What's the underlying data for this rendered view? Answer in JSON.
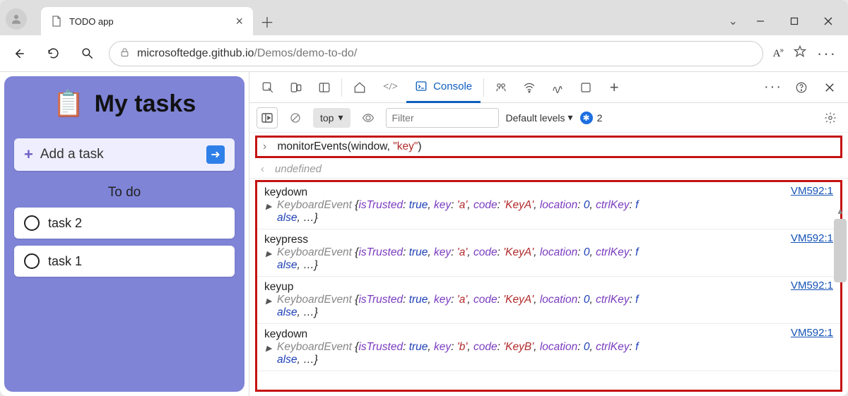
{
  "window": {
    "tab_title": "TODO app",
    "url_host": "microsoftedge.github.io",
    "url_path": "/Demos/demo-to-do/"
  },
  "app": {
    "title": "My tasks",
    "add_label": "Add a task",
    "section": "To do",
    "tasks": [
      "task 2",
      "task 1"
    ]
  },
  "devtools": {
    "console_tab": "Console",
    "context": "top",
    "filter_placeholder": "Filter",
    "levels": "Default levels",
    "issue_count": "2",
    "command_func": "monitorEvents",
    "command_arg1": "window",
    "command_arg2": "\"key\"",
    "undefined_label": "undefined",
    "vm_link": "VM592:1",
    "events": [
      {
        "name": "keydown",
        "key": "'a'",
        "code": "'KeyA'"
      },
      {
        "name": "keypress",
        "key": "'a'",
        "code": "'KeyA'"
      },
      {
        "name": "keyup",
        "key": "'a'",
        "code": "'KeyA'"
      },
      {
        "name": "keydown",
        "key": "'b'",
        "code": "'KeyB'"
      }
    ],
    "obj_class": "KeyboardEvent",
    "k_isTrusted": "isTrusted",
    "v_true": "true",
    "k_key": "key",
    "k_code": "code",
    "k_location": "location",
    "v_zero": "0",
    "k_ctrl": "ctrlKey",
    "v_false_part1": "f",
    "v_false_part2": "alse",
    "ellipsis": "…"
  }
}
